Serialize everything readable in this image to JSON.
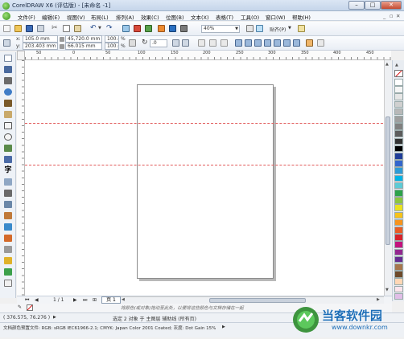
{
  "window": {
    "title": "CorelDRAW X6 (评估版) - [未命名 -1]"
  },
  "menu": [
    "文件(F)",
    "编辑(E)",
    "视图(V)",
    "布局(L)",
    "排列(A)",
    "效果(C)",
    "位图(B)",
    "文本(X)",
    "表格(T)",
    "工具(O)",
    "窗口(W)",
    "帮助(H)"
  ],
  "toolbar": {
    "zoom_value": "40%",
    "snap_label": "贴齐(P)"
  },
  "propbar": {
    "x_value": "105.0 mm",
    "y_value": "203.403 mm",
    "w_value": "45,720.0 mm",
    "h_value": "66.015 mm",
    "scale_x": "100.0",
    "scale_y": "100.0",
    "scale_unit": "%",
    "rotate_value": ".0"
  },
  "ruler_ticks": [
    "100",
    "50",
    "0",
    "50",
    "100",
    "150",
    "200",
    "250",
    "300",
    "350",
    "400",
    "450"
  ],
  "nav": {
    "page_counter": "1 / 1",
    "page_tab": "页 1"
  },
  "hint_text": "将颜色(或对象)拖动至此处，以便将这些颜色与文档存储在一起",
  "status": {
    "coords": "( 376.575, 76.276 )",
    "selection": "选定 2 对象 于 主图层 辅助线 (所有页)",
    "color_profile": "文档颜色预置文件: RGB: sRGB IEC61966-2.1; CMYK: Japan Color 2001 Coated; 灰度: Dot Gain 15%"
  },
  "watermark": {
    "brand": "当客软件园",
    "url": "www.downkr.com"
  },
  "palette_colors": [
    "#ffffff",
    "#f5f5f5",
    "#e6e6e6",
    "#d0d0d0",
    "#b8b8b8",
    "#9e9e9e",
    "#808080",
    "#5c5c5c",
    "#333333",
    "#000000",
    "#1f3d99",
    "#3366cc",
    "#2e9bd6",
    "#00b3e6",
    "#5ccbd6",
    "#2ca24a",
    "#8cc63f",
    "#e9e21f",
    "#f7c21a",
    "#f7941d",
    "#e85c24",
    "#d6232b",
    "#c3127d",
    "#93278f",
    "#662d91",
    "#a6764d",
    "#6e4a2a",
    "#ffd7b5",
    "#fce4ec",
    "#e1bee7"
  ]
}
